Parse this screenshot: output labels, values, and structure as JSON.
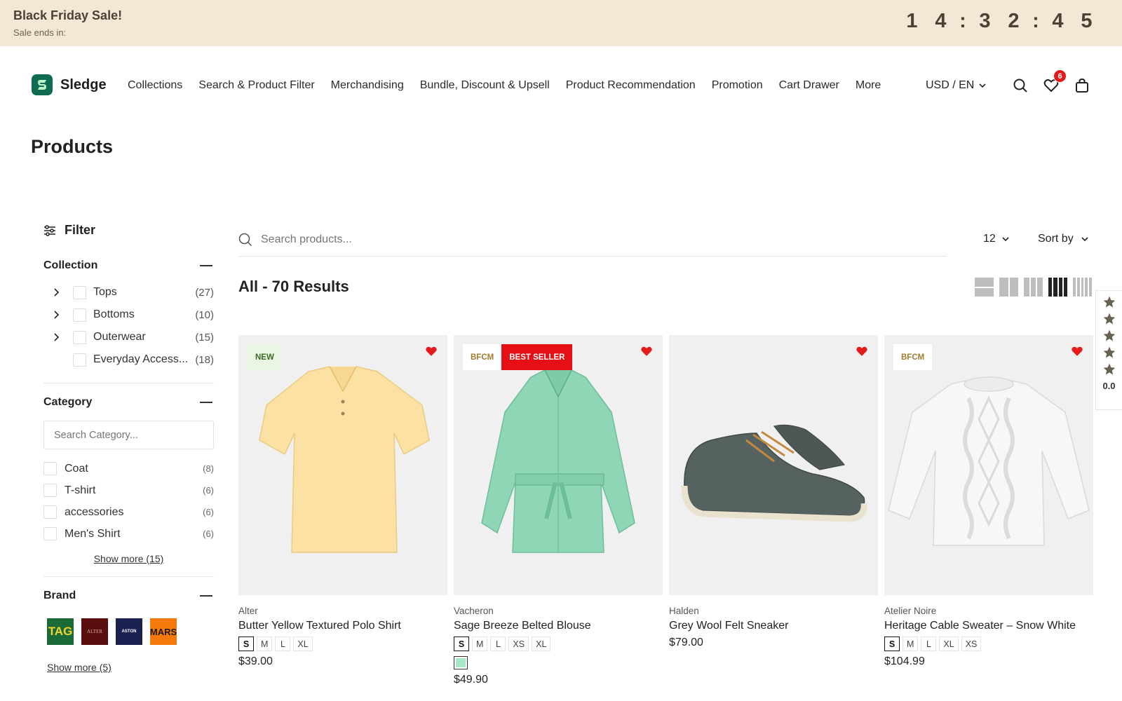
{
  "announcement": {
    "title": "Black Friday Sale!",
    "subtitle": "Sale ends in:",
    "countdown": [
      "1",
      "4",
      ":",
      "3",
      "2",
      ":",
      "4",
      "5"
    ]
  },
  "header": {
    "brand": "Sledge",
    "nav": [
      "Collections",
      "Search & Product Filter",
      "Merchandising",
      "Bundle, Discount & Upsell",
      "Product Recommendation",
      "Promotion",
      "Cart Drawer",
      "More"
    ],
    "locale": "USD / EN",
    "wishlist_count": "6",
    "icons": [
      "search-icon",
      "heart-icon",
      "shopping-bag-icon"
    ]
  },
  "page": {
    "title": "Products"
  },
  "filter": {
    "title": "Filter",
    "collection": {
      "title": "Collection",
      "items": [
        {
          "label": "Tops",
          "count": "(27)"
        },
        {
          "label": "Bottoms",
          "count": "(10)"
        },
        {
          "label": "Outerwear",
          "count": "(15)"
        },
        {
          "label": "Everyday Access...",
          "count": "(18)"
        }
      ]
    },
    "category": {
      "title": "Category",
      "search_placeholder": "Search Category...",
      "items": [
        {
          "label": "Coat",
          "count": "(8)"
        },
        {
          "label": "T-shirt",
          "count": "(6)"
        },
        {
          "label": "accessories",
          "count": "(6)"
        },
        {
          "label": "Men's Shirt",
          "count": "(6)"
        }
      ],
      "show_more": "Show more (15)"
    },
    "brand": {
      "title": "Brand",
      "logos": [
        {
          "text": "TAG",
          "bg": "#1a6b35",
          "fg": "#f2d230"
        },
        {
          "text": "ALTER",
          "bg": "#5a0f0f",
          "fg": "#d9b0a0"
        },
        {
          "text": "ASTON",
          "bg": "#1b2150",
          "fg": "#ffffff"
        },
        {
          "text": "MARS",
          "bg": "#f47a0c",
          "fg": "#1a1a1a"
        }
      ],
      "show_more": "Show more (5)"
    }
  },
  "toolbar": {
    "search_placeholder": "Search products...",
    "per_page": "12",
    "sort_label": "Sort by",
    "results": "All - 70 Results",
    "view_active": 4
  },
  "products": [
    {
      "vendor": "Alter",
      "name": "Butter Yellow Textured Polo Shirt",
      "price": "$39.00",
      "tags": [
        {
          "text": "NEW",
          "kind": "new"
        }
      ],
      "sizes": [
        "S",
        "M",
        "L",
        "XL"
      ],
      "selected_size": "S",
      "swatch": ""
    },
    {
      "vendor": "Vacheron",
      "name": "Sage Breeze Belted Blouse",
      "price": "$49.90",
      "tags": [
        {
          "text": "BFCM",
          "kind": "bfcm"
        },
        {
          "text": "BEST SELLER",
          "kind": "best"
        }
      ],
      "sizes": [
        "S",
        "M",
        "L",
        "XS",
        "XL"
      ],
      "selected_size": "S",
      "swatch": "#a5e7c6"
    },
    {
      "vendor": "Halden",
      "name": "Grey Wool Felt Sneaker",
      "price": "$79.00",
      "tags": [],
      "sizes": [],
      "selected_size": "",
      "swatch": ""
    },
    {
      "vendor": "Atelier Noire",
      "name": "Heritage Cable Sweater – Snow White",
      "price": "$104.99",
      "tags": [
        {
          "text": "BFCM",
          "kind": "bfcm"
        }
      ],
      "sizes": [
        "S",
        "M",
        "L",
        "XL",
        "XS"
      ],
      "selected_size": "S",
      "swatch": ""
    }
  ],
  "rating_widget": {
    "stars": 5,
    "score": "0.0"
  },
  "colors": {
    "accent": "#0f6b52",
    "announce_bg": "#f2e8d5",
    "badge": "#e31b1b",
    "heart": "#e31b1b",
    "best_seller": "#e60f16"
  }
}
